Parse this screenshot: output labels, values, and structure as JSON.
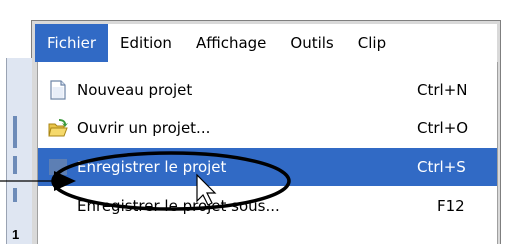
{
  "menubar": {
    "items": [
      {
        "label": "Fichier",
        "active": true
      },
      {
        "label": "Edition",
        "active": false
      },
      {
        "label": "Affichage",
        "active": false
      },
      {
        "label": "Outils",
        "active": false
      },
      {
        "label": "Clip",
        "active": false
      }
    ]
  },
  "menu": {
    "items": [
      {
        "label": "Nouveau projet",
        "shortcut": "Ctrl+N",
        "icon": "new-document-icon"
      },
      {
        "label": "Ouvrir un projet...",
        "shortcut": "Ctrl+O",
        "icon": "open-folder-icon"
      },
      {
        "label": "Enregistrer le projet",
        "shortcut": "Ctrl+S",
        "icon": "save-icon",
        "highlighted": true
      },
      {
        "label": "Enregistrer le projet sous...",
        "shortcut": "F12",
        "icon": ""
      }
    ]
  },
  "side": {
    "line_number": "1"
  },
  "colors": {
    "highlight": "#316ac5",
    "menu_bg": "#ffffff",
    "window_frame": "#d9d9d9"
  }
}
